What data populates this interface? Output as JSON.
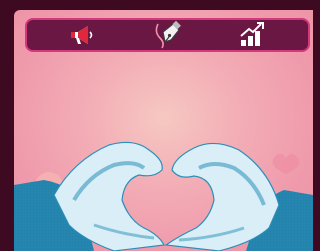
{
  "toolbar": {
    "tools": [
      {
        "id": "announce",
        "icon": "megaphone-icon"
      },
      {
        "id": "write",
        "icon": "pen-nib-icon"
      },
      {
        "id": "growth",
        "icon": "growth-chart-icon"
      }
    ]
  },
  "illustration": {
    "subject": "heart-hands-icon"
  },
  "colors": {
    "background_dark": "#3d0a22",
    "toolbar_fill": "#6b1744",
    "toolbar_border": "#d3397f",
    "accent_red": "#e0283c",
    "hand_blue": "#2a8fb8"
  }
}
